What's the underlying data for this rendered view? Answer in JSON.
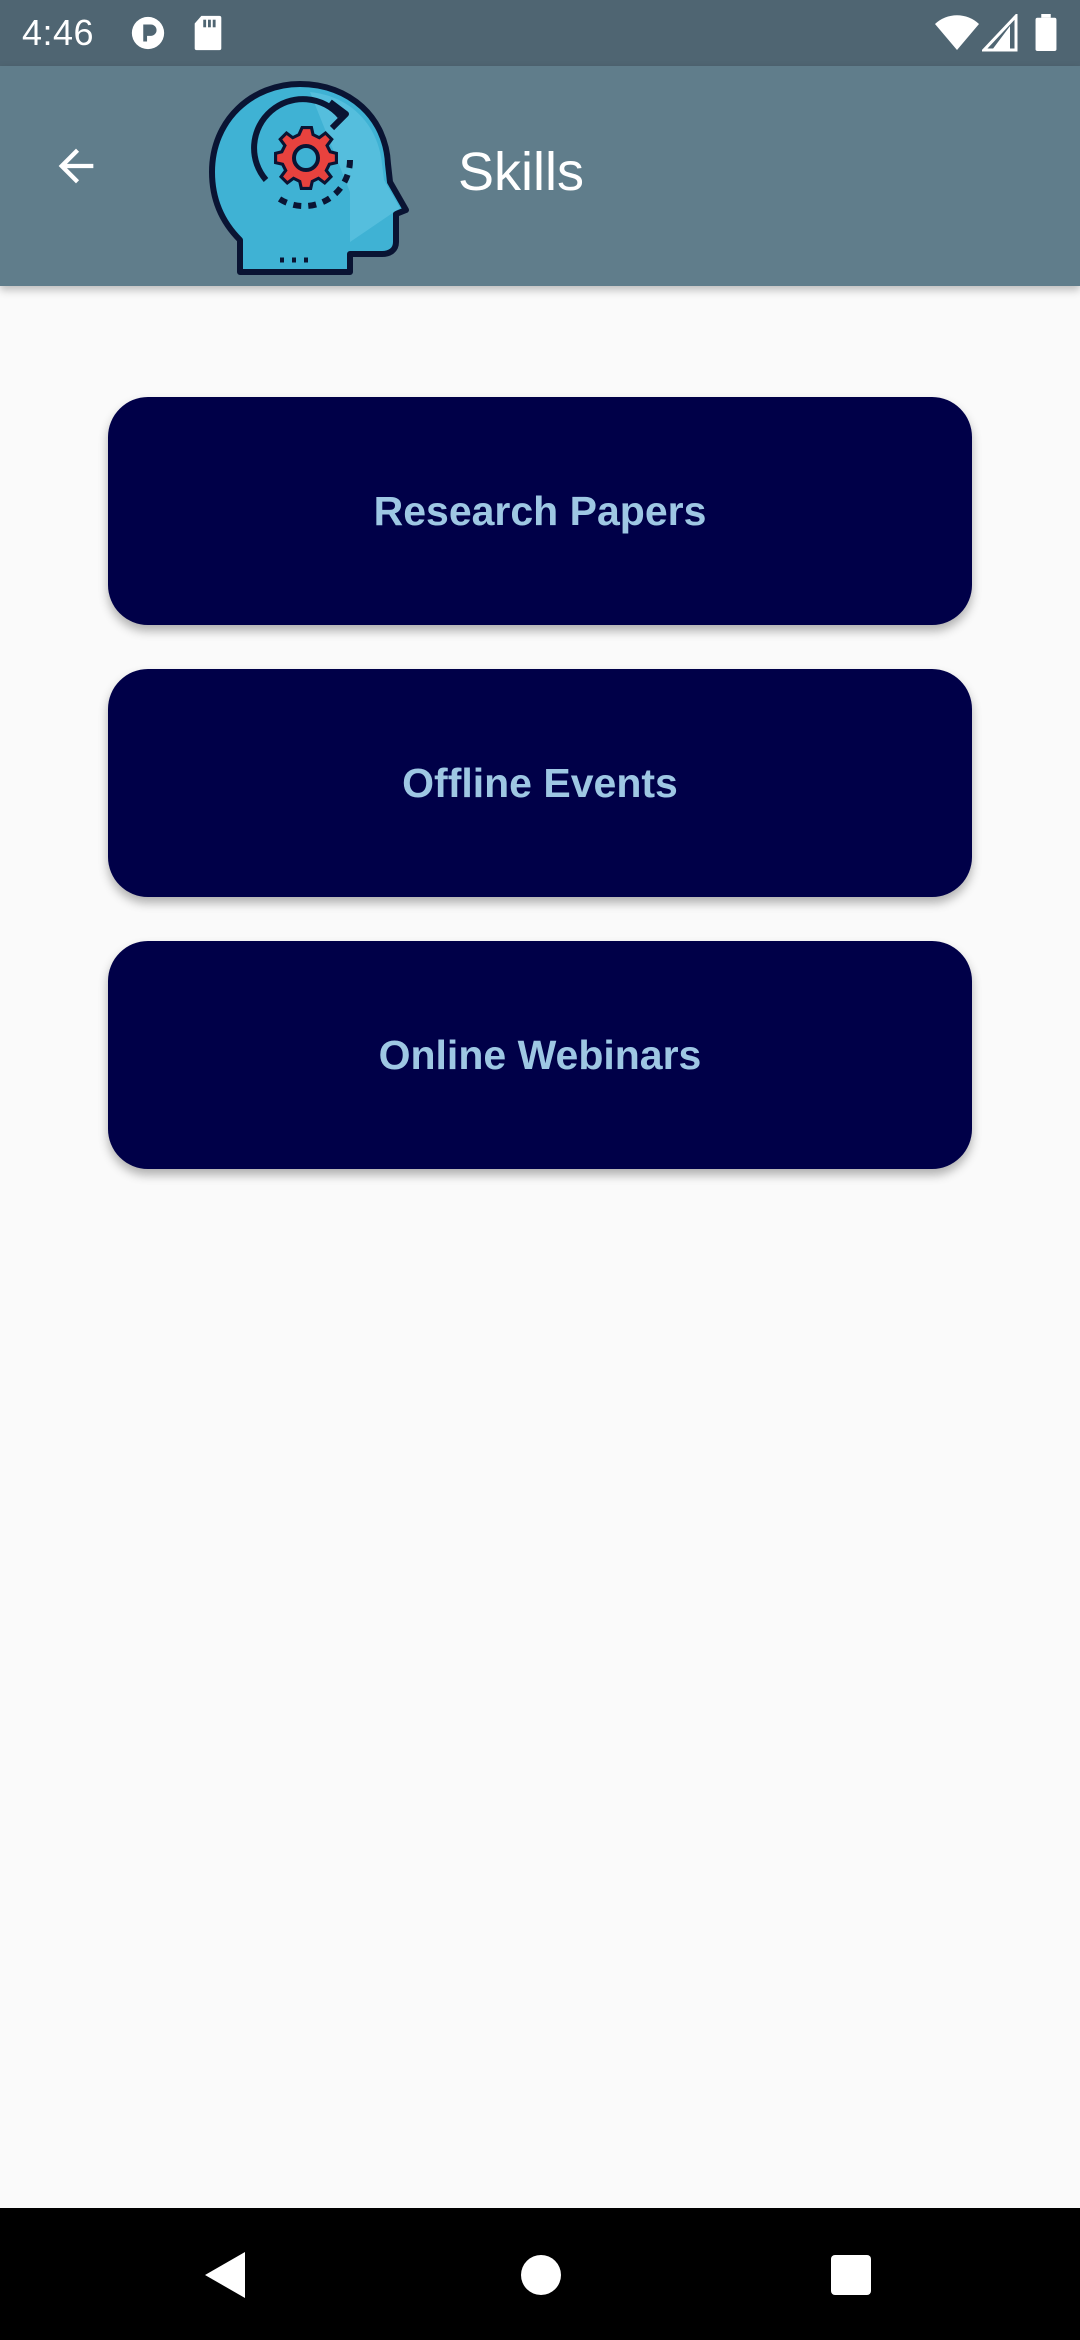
{
  "status_bar": {
    "time": "4:46",
    "icons": [
      "data-saver-icon",
      "sd-card-icon",
      "wifi-icon",
      "cell-signal-icon",
      "battery-icon"
    ]
  },
  "app_bar": {
    "title": "Skills",
    "back_icon": "arrow-back-icon",
    "logo_icon": "head-gear-icon"
  },
  "menu": {
    "items": [
      {
        "label": "Research Papers"
      },
      {
        "label": "Offline Events"
      },
      {
        "label": "Online Webinars"
      }
    ]
  },
  "nav_bar": {
    "icons": [
      "nav-back-icon",
      "nav-home-icon",
      "nav-recents-icon"
    ]
  },
  "colors": {
    "status_bar": "#4f6572",
    "app_bar": "#607d8b",
    "background": "#fafafa",
    "card": "#000048",
    "card_text": "#9ec7e3"
  }
}
